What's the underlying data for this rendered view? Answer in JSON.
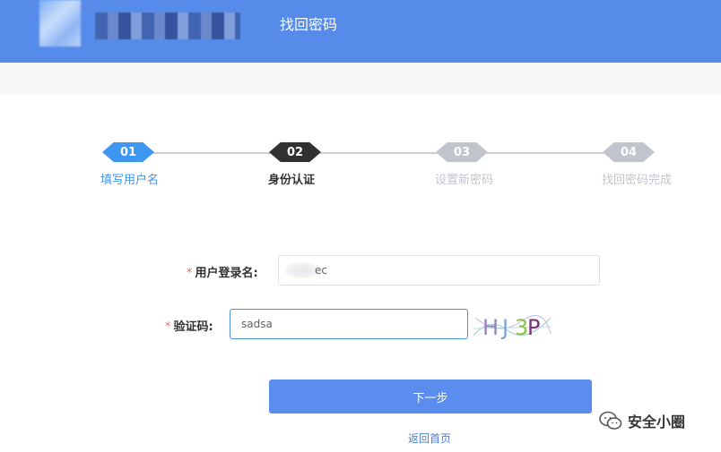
{
  "header": {
    "title": "找回密码"
  },
  "steps": [
    {
      "num": "01",
      "label": "填写用户名",
      "state": "done"
    },
    {
      "num": "02",
      "label": "身份认证",
      "state": "active"
    },
    {
      "num": "03",
      "label": "设置新密码",
      "state": "pending"
    },
    {
      "num": "04",
      "label": "找回密码完成",
      "state": "pending"
    }
  ],
  "colors": {
    "header_bg": "#568be9",
    "step_done": "#3d97f0",
    "step_active": "#303133",
    "step_pending": "#c0c4cc",
    "primary_button": "#5a8ded"
  },
  "form": {
    "required_mark": "*",
    "username": {
      "label": "用户登录名:",
      "value_visible_suffix": "ec"
    },
    "captcha": {
      "label": "验证码:",
      "value": "sadsa",
      "image_text": "HJ3P"
    }
  },
  "actions": {
    "next_label": "下一步",
    "back_label": "返回首页"
  },
  "watermark": {
    "icon": "wechat-icon",
    "text": "安全小圈"
  }
}
